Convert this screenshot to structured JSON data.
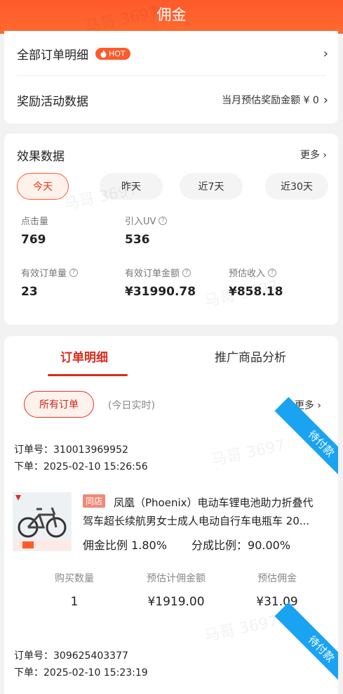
{
  "header": {
    "title": "佣金"
  },
  "top_card": {
    "all_orders": {
      "label": "全部订单明细",
      "hot": "HOT",
      "chevron": "›"
    },
    "reward": {
      "label": "奖励活动数据",
      "sub": "当月预估奖励金额 ¥ 0",
      "chevron": "›"
    }
  },
  "effect": {
    "title": "效果数据",
    "more": "更多 ›",
    "periods": [
      "今天",
      "昨天",
      "近7天",
      "近30天"
    ],
    "active_period": "今天",
    "metrics": [
      {
        "label": "点击量",
        "value": "769",
        "help": false
      },
      {
        "label": "引入UV",
        "value": "536",
        "help": true
      },
      {
        "label": "有效订单量",
        "value": "23",
        "help": true
      },
      {
        "label": "有效订单金额",
        "value": "¥31990.78",
        "help": true
      },
      {
        "label": "预估收入",
        "value": "¥858.18",
        "help": true
      }
    ]
  },
  "orders": {
    "tabs": [
      "订单明细",
      "推广商品分析"
    ],
    "active_tab": "订单明细",
    "filter": "所有订单",
    "realtime": "(今日实时)",
    "more": "更多 ›",
    "list": [
      {
        "status": "待付款",
        "order_no": "订单号：310013969952",
        "order_time": "下单：2025-02-10 15:26:56",
        "shop_tag": "同店",
        "title_l1": "凤凰（Phoenix）电动车锂电池助力折叠代",
        "title_l2": "驾车超长续航男女士成人电动自行车电瓶车 20...",
        "commission_rate": "佣金比例 1.80%",
        "share_rate": "分成比例：90.00%",
        "stats": [
          {
            "label": "购买数量",
            "value": "1"
          },
          {
            "label": "预估计佣金额",
            "value": "¥1919.00"
          },
          {
            "label": "预估佣金",
            "value": "¥31.09"
          }
        ]
      },
      {
        "status": "待付款",
        "order_no": "订单号：309625403377",
        "order_time": "下单：2025-02-10 15:23:19"
      }
    ]
  },
  "watermark": "马哥 3697",
  "colors": {
    "primary": "#ff5a2b",
    "ribbon": "#1aa3f0",
    "tab_active": "#d92b1a"
  }
}
